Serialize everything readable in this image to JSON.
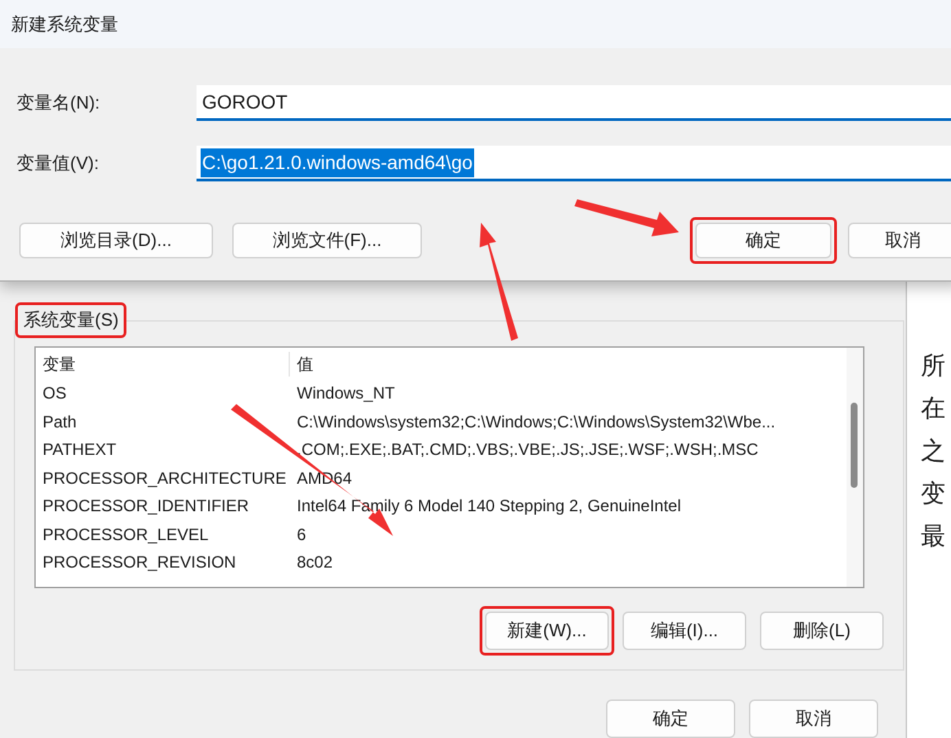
{
  "dialog": {
    "title": "新建系统变量",
    "fields": [
      {
        "label": "变量名(N):",
        "value": "GOROOT",
        "text_selected": false
      },
      {
        "label": "变量值(V):",
        "value": "C:\\go1.21.0.windows-amd64\\go",
        "text_selected": true
      }
    ],
    "buttons": [
      {
        "label": "浏览目录(D)...",
        "highlighted": false
      },
      {
        "label": "浏览文件(F)...",
        "highlighted": false
      },
      {
        "label": "确定",
        "highlighted": true
      },
      {
        "label": "取消",
        "highlighted": false
      }
    ]
  },
  "system_variables": {
    "title": "系统变量(S)",
    "title_highlighted": true,
    "columns": [
      "变量",
      "值"
    ],
    "rows": [
      [
        "OS",
        "Windows_NT"
      ],
      [
        "Path",
        "C:\\Windows\\system32;C:\\Windows;C:\\Windows\\System32\\Wbe..."
      ],
      [
        "PATHEXT",
        ".COM;.EXE;.BAT;.CMD;.VBS;.VBE;.JS;.JSE;.WSF;.WSH;.MSC"
      ],
      [
        "PROCESSOR_ARCHITECTURE",
        "AMD64"
      ],
      [
        "PROCESSOR_IDENTIFIER",
        "Intel64 Family 6 Model 140 Stepping 2, GenuineIntel"
      ],
      [
        "PROCESSOR_LEVEL",
        "6"
      ],
      [
        "PROCESSOR_REVISION",
        "8c02"
      ]
    ],
    "buttons": [
      {
        "label": "新建(W)...",
        "highlighted": true
      },
      {
        "label": "编辑(I)...",
        "highlighted": false
      },
      {
        "label": "删除(L)",
        "highlighted": false
      }
    ]
  },
  "footer_buttons": [
    "确定",
    "取消"
  ],
  "background_text": [
    "所",
    "在",
    "之",
    "变",
    "最"
  ]
}
